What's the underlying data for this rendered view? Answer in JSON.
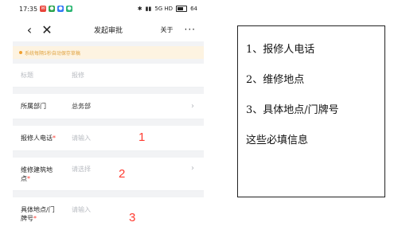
{
  "status_bar": {
    "time": "17:35",
    "network_info": "5G    HD",
    "battery": "64"
  },
  "nav": {
    "title": "发起审批",
    "about": "关于",
    "more": "···"
  },
  "notice": "系统每隔5秒自动保存草稿",
  "form": {
    "title": {
      "label": "标题",
      "value": "报修"
    },
    "department": {
      "label": "所属部门",
      "value": "总务部"
    },
    "phone": {
      "label": "报修人电话",
      "placeholder": "请输入",
      "annotation": "1"
    },
    "building": {
      "label_line1": "维修建筑地",
      "label_line2": "点",
      "placeholder": "请选择",
      "annotation": "2"
    },
    "address": {
      "label_line1": "具体地点/门",
      "label_line2": "牌号",
      "placeholder": "请输入",
      "annotation": "3"
    }
  },
  "notes": [
    "1、报修人电话",
    "2、维修地点",
    "3、具体地点/门牌号",
    "这些必填信息"
  ],
  "colors": {
    "accent_red": "#ff3b30",
    "notice_bg": "#fdf3e1",
    "notice_text": "#e0a443"
  }
}
